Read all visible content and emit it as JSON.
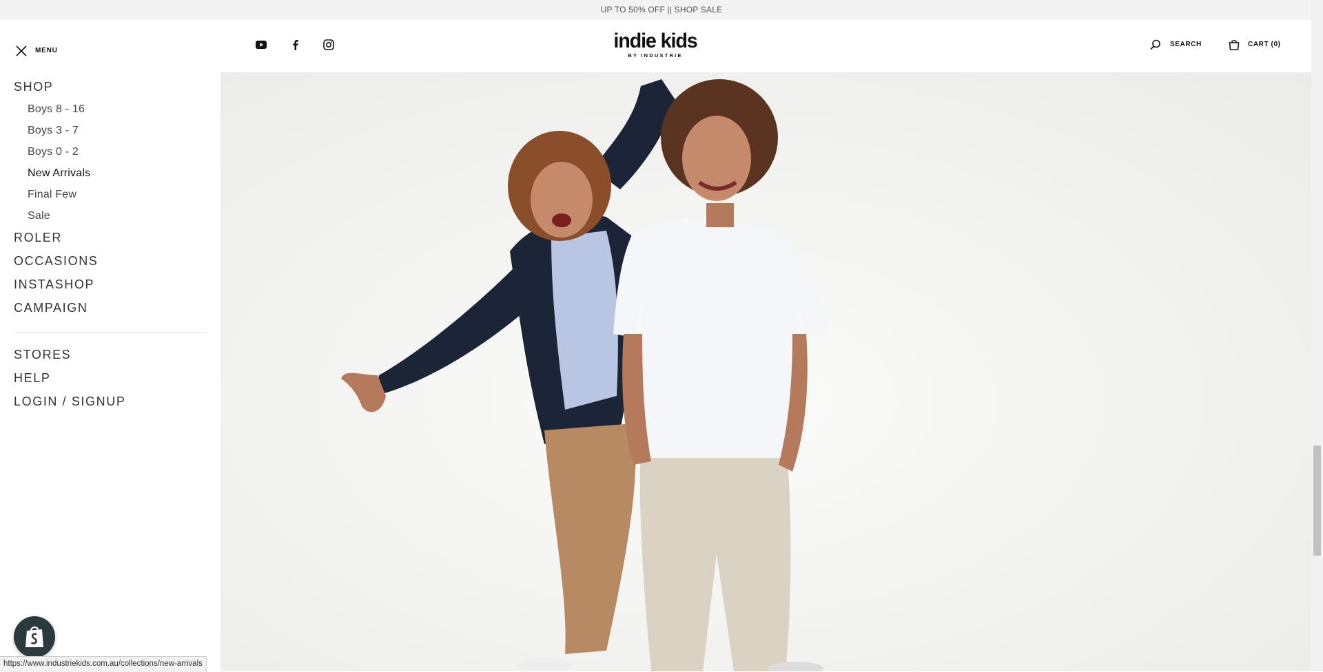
{
  "announcement": "UP TO 50% OFF || SHOP SALE",
  "header": {
    "menu_label": "MENU",
    "logo_main": "indie kids",
    "logo_sub": "BY INDUSTRIE",
    "search_label": "SEARCH",
    "cart_label": "CART (0)",
    "social_icons": [
      "youtube-icon",
      "facebook-icon",
      "instagram-icon"
    ]
  },
  "menu": {
    "shop": "SHOP",
    "shop_items": [
      "Boys 8 - 16",
      "Boys 3 - 7",
      "Boys 0 - 2",
      "New Arrivals",
      "Final Few",
      "Sale"
    ],
    "active_item": "New Arrivals",
    "roler": "ROLER",
    "occasions": "OCCASIONS",
    "instashop": "INSTASHOP",
    "campaign": "CAMPAIGN",
    "stores": "STORES",
    "help": "HELP",
    "login": "LOGIN / SIGNUP"
  },
  "status_url": "https://www.industriekids.com.au/collections/new-arrivals",
  "colors": {
    "announcement_bg": "#f3f3f3",
    "hero_bg": "#f1f1ef",
    "text_dark": "#111111",
    "shopify_badge": "#2b3a3f"
  }
}
